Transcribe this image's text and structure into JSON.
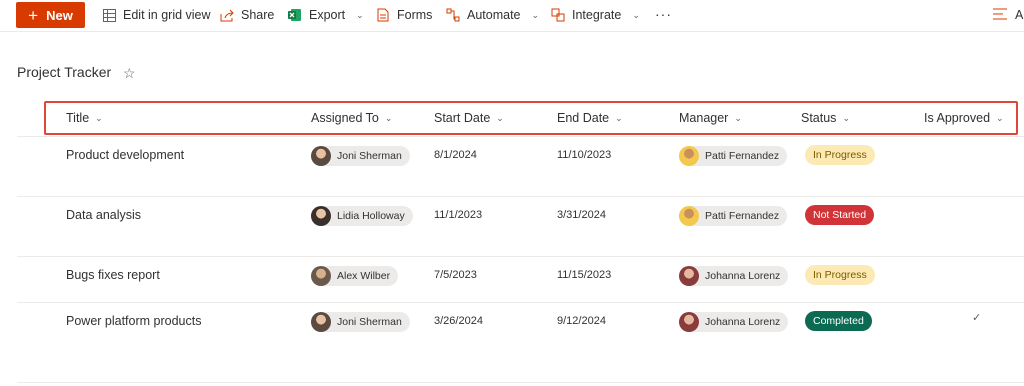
{
  "toolbar": {
    "new_label": "New",
    "edit_grid_label": "Edit in grid view",
    "share_label": "Share",
    "export_label": "Export",
    "forms_label": "Forms",
    "automate_label": "Automate",
    "integrate_label": "Integrate",
    "more_label": "···",
    "view_label": "Al"
  },
  "page": {
    "title": "Project Tracker"
  },
  "columns": {
    "title": "Title",
    "assigned_to": "Assigned To",
    "start_date": "Start Date",
    "end_date": "End Date",
    "manager": "Manager",
    "status": "Status",
    "is_approved": "Is Approved"
  },
  "rows": [
    {
      "title": "Product development",
      "assigned_to": "Joni Sherman",
      "start_date": "8/1/2024",
      "end_date": "11/10/2023",
      "manager": "Patti Fernandez",
      "status": "In Progress",
      "is_approved": ""
    },
    {
      "title": "Data analysis",
      "assigned_to": "Lidia Holloway",
      "start_date": "11/1/2023",
      "end_date": "3/31/2024",
      "manager": "Patti Fernandez",
      "status": "Not Started",
      "is_approved": ""
    },
    {
      "title": "Bugs fixes report",
      "assigned_to": "Alex Wilber",
      "start_date": "7/5/2023",
      "end_date": "11/15/2023",
      "manager": "Johanna Lorenz",
      "status": "In Progress",
      "is_approved": ""
    },
    {
      "title": "Power platform products",
      "assigned_to": "Joni Sherman",
      "start_date": "3/26/2024",
      "end_date": "9/12/2024",
      "manager": "Johanna Lorenz",
      "status": "Completed",
      "is_approved": "✓"
    }
  ],
  "colors": {
    "new_button": "#d83b01",
    "in_progress_bg": "#fce9b4",
    "not_started_bg": "#d13438",
    "completed_bg": "#0b6a52",
    "highlight_box": "#e0453a"
  }
}
